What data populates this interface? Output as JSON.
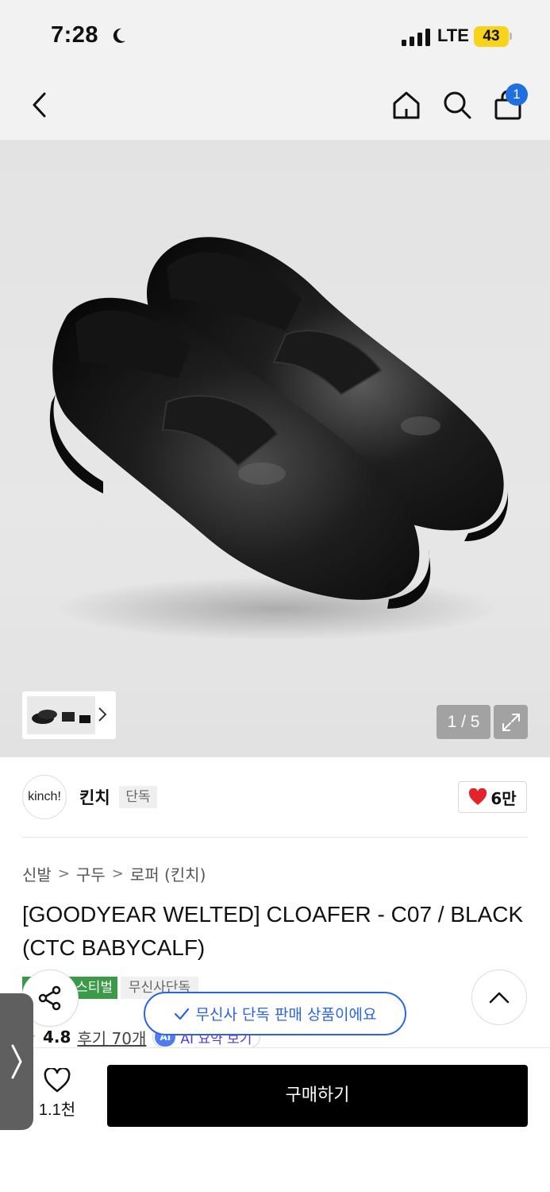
{
  "status_bar": {
    "time": "7:28",
    "network": "LTE",
    "battery": "43"
  },
  "nav": {
    "cart_count": "1"
  },
  "gallery": {
    "counter": "1 / 5"
  },
  "brand": {
    "logo_text": "kinch!",
    "name": "킨치",
    "exclusive_tag": "단독",
    "likes": "6만"
  },
  "breadcrumb": [
    "신발",
    "구두",
    "로퍼 (킨치)"
  ],
  "product": {
    "title": "[GOODYEAR WELTED] CLOAFER - C07 / BLACK (CTC BABYCALF)",
    "tag_festival": "스티벌",
    "tag_exclusive": "무신사단독",
    "rating": "4.8",
    "reviews": "후기 70개",
    "ai_badge": "AI",
    "ai_label": "AI 요약 보기"
  },
  "toast": {
    "text": "무신사 단독 판매 상품이에요"
  },
  "bottom": {
    "wish_count": "1.1천",
    "buy_label": "구매하기"
  },
  "colors": {
    "accent_blue": "#2a63e5",
    "badge_blue": "#1f6fe0",
    "heart_red": "#e3242b",
    "festival_green": "#3a9a47",
    "battery_yellow": "#f7d31a"
  }
}
